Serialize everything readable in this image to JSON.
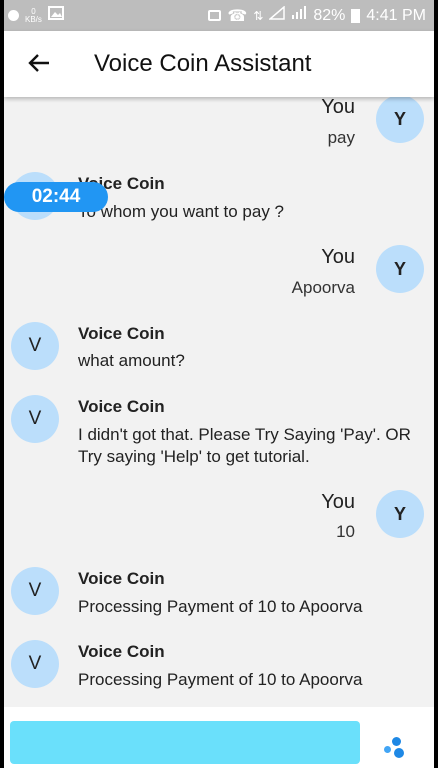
{
  "status_bar": {
    "net_speed_value": "0",
    "net_speed_unit": "KB/s",
    "battery": "82%",
    "time": "4:41 PM"
  },
  "app_bar": {
    "title": "Voice Coin Assistant"
  },
  "timer": "02:44",
  "messages": [
    {
      "sender": "You",
      "avatar": "Y",
      "text": "pay"
    },
    {
      "sender": "Voice Coin",
      "avatar": "V",
      "text": "To whom you want to pay ?"
    },
    {
      "sender": "You",
      "avatar": "Y",
      "text": "Apoorva"
    },
    {
      "sender": "Voice Coin",
      "avatar": "V",
      "text": "what amount?"
    },
    {
      "sender": "Voice Coin",
      "avatar": "V",
      "text": "I didn't got that. Please Try Saying 'Pay'. OR Try saying 'Help' to get tutorial."
    },
    {
      "sender": "You",
      "avatar": "Y",
      "text": "10"
    },
    {
      "sender": "Voice Coin",
      "avatar": "V",
      "text": "Processing Payment of 10 to Apoorva"
    },
    {
      "sender": "Voice Coin",
      "avatar": "V",
      "text": "Processing Payment of 10 to Apoorva"
    }
  ],
  "input": {
    "value": "",
    "placeholder": ""
  },
  "colors": {
    "avatar_bg": "#bbdefb",
    "timer_bg": "#2196f3",
    "input_bg": "#6ae0fb",
    "status_bar_bg": "#bdbdbd"
  }
}
